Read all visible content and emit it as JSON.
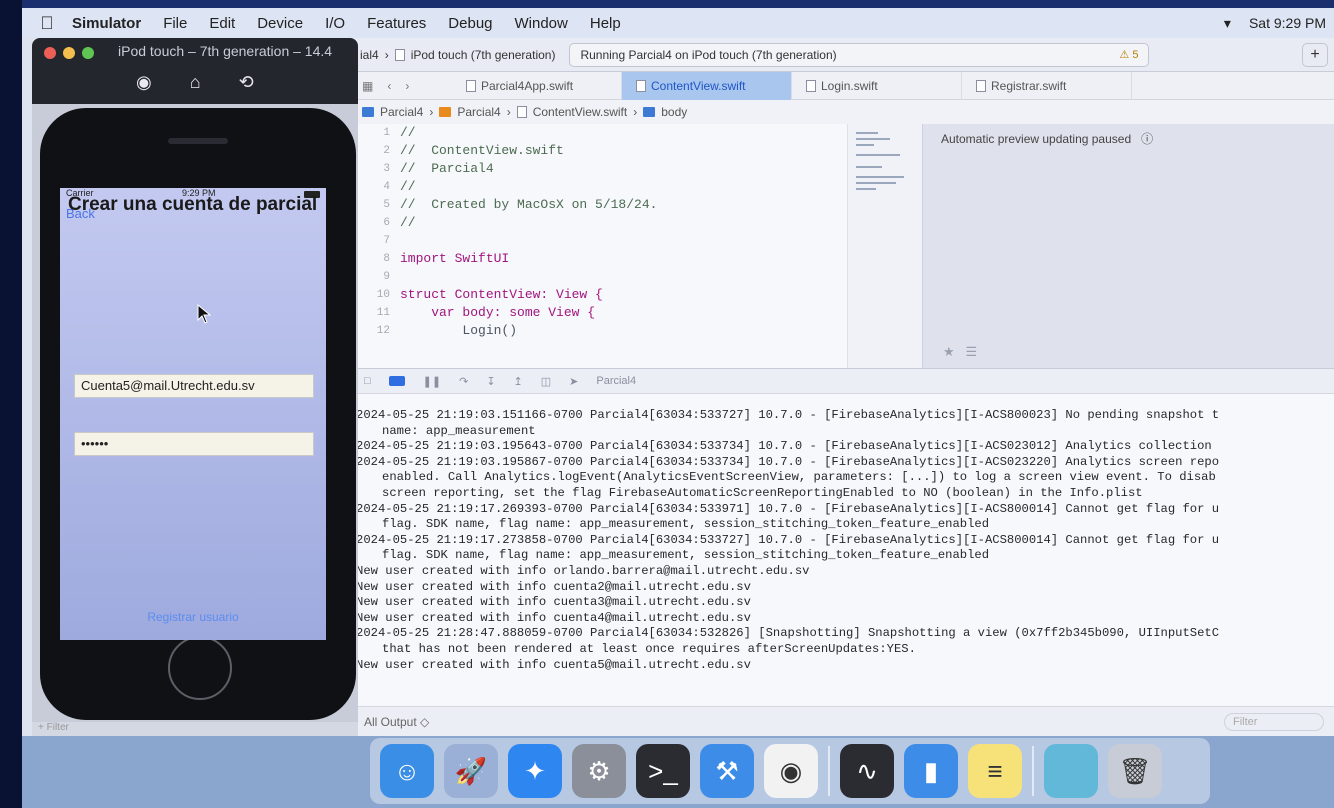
{
  "menubar": {
    "app": "Simulator",
    "items": [
      "File",
      "Edit",
      "Device",
      "I/O",
      "Features",
      "Debug",
      "Window",
      "Help"
    ],
    "clock": "Sat 9:29 PM"
  },
  "xcode": {
    "scheme_project": "ial4",
    "scheme_device": "iPod touch (7th generation)",
    "status": "Running Parcial4 on iPod touch (7th generation)",
    "warnings": "5",
    "tabs": [
      "Parcial4App.swift",
      "ContentView.swift",
      "Login.swift",
      "Registrar.swift"
    ],
    "breadcrumb": [
      "Parcial4",
      "Parcial4",
      "ContentView.swift",
      "body"
    ],
    "code": [
      {
        "n": "1",
        "t": "//",
        "k": "cm"
      },
      {
        "n": "2",
        "t": "//  ContentView.swift",
        "k": "cm"
      },
      {
        "n": "3",
        "t": "//  Parcial4",
        "k": "cm"
      },
      {
        "n": "4",
        "t": "//",
        "k": "cm"
      },
      {
        "n": "5",
        "t": "//  Created by MacOsX on 5/18/24.",
        "k": "cm"
      },
      {
        "n": "6",
        "t": "//",
        "k": "cm"
      },
      {
        "n": "7",
        "t": "",
        "k": ""
      },
      {
        "n": "8",
        "t": "import SwiftUI",
        "k": "kw"
      },
      {
        "n": "9",
        "t": "",
        "k": ""
      },
      {
        "n": "10",
        "t": "struct ContentView: View {",
        "k": "kw"
      },
      {
        "n": "11",
        "t": "    var body: some View {",
        "k": "kw"
      },
      {
        "n": "12",
        "t": "        Login()",
        "k": ""
      }
    ],
    "preview_status": "Automatic preview updating paused",
    "debug_target": "Parcial4",
    "console": [
      {
        "t": "2024-05-25 21:19:03.151166-0700 Parcial4[63034:533727] 10.7.0 - [FirebaseAnalytics][I-ACS800023] No pending snapshot t",
        "i": false
      },
      {
        "t": "name: app_measurement",
        "i": true
      },
      {
        "t": "2024-05-25 21:19:03.195643-0700 Parcial4[63034:533734] 10.7.0 - [FirebaseAnalytics][I-ACS023012] Analytics collection",
        "i": false
      },
      {
        "t": "2024-05-25 21:19:03.195867-0700 Parcial4[63034:533734] 10.7.0 - [FirebaseAnalytics][I-ACS023220] Analytics screen repo",
        "i": false
      },
      {
        "t": "enabled. Call Analytics.logEvent(AnalyticsEventScreenView, parameters: [...]) to log a screen view event. To disab",
        "i": true
      },
      {
        "t": "screen reporting, set the flag FirebaseAutomaticScreenReportingEnabled to NO (boolean) in the Info.plist",
        "i": true
      },
      {
        "t": "2024-05-25 21:19:17.269393-0700 Parcial4[63034:533971] 10.7.0 - [FirebaseAnalytics][I-ACS800014] Cannot get flag for u",
        "i": false
      },
      {
        "t": "flag. SDK name, flag name: app_measurement, session_stitching_token_feature_enabled",
        "i": true
      },
      {
        "t": "2024-05-25 21:19:17.273858-0700 Parcial4[63034:533727] 10.7.0 - [FirebaseAnalytics][I-ACS800014] Cannot get flag for u",
        "i": false
      },
      {
        "t": "flag. SDK name, flag name: app_measurement, session_stitching_token_feature_enabled",
        "i": true
      },
      {
        "t": "New user created with info orlando.barrera@mail.utrecht.edu.sv",
        "i": false
      },
      {
        "t": "New user created with info cuenta2@mail.utrecht.edu.sv",
        "i": false
      },
      {
        "t": "New user created with info cuenta3@mail.utrecht.edu.sv",
        "i": false
      },
      {
        "t": "New user created with info cuenta4@mail.utrecht.edu.sv",
        "i": false
      },
      {
        "t": "2024-05-25 21:28:47.888059-0700 Parcial4[63034:532826] [Snapshotting] Snapshotting a view (0x7ff2b345b090, UIInputSetC",
        "i": false
      },
      {
        "t": "that has not been rendered at least once requires afterScreenUpdates:YES.",
        "i": true
      },
      {
        "t": "New user created with info cuenta5@mail.utrecht.edu.sv",
        "i": false
      }
    ],
    "output_selector": "All Output ◇",
    "filter_placeholder": "Filter"
  },
  "simulator": {
    "title": "iPod touch – 7th generation – 14.4",
    "screen": {
      "carrier": "Carrier",
      "time": "9:29 PM",
      "back": "Back",
      "title": "Crear una cuenta de parcial",
      "email_value": "Cuenta5@mail.Utrecht.edu.sv",
      "password_value": "••••••",
      "register_button": "Registrar usuario"
    },
    "filter_placeholder": "Filter"
  },
  "dock": {
    "apps": [
      {
        "name": "Finder",
        "color": "#3a8ee6",
        "glyph": "☺"
      },
      {
        "name": "Launchpad",
        "color": "#9ab0d6",
        "glyph": "🚀"
      },
      {
        "name": "Safari",
        "color": "#2e86f0",
        "glyph": "✦"
      },
      {
        "name": "System Preferences",
        "color": "#8a8f99",
        "glyph": "⚙"
      },
      {
        "name": "Terminal",
        "color": "#2a2c31",
        "glyph": ">_"
      },
      {
        "name": "Xcode",
        "color": "#3d8ce8",
        "glyph": "⚒"
      },
      {
        "name": "Chrome",
        "color": "#f2f2f2",
        "glyph": "◉"
      },
      {
        "name": "Activity Monitor",
        "color": "#2a2c31",
        "glyph": "∿"
      },
      {
        "name": "Simulator",
        "color": "#3d8ce8",
        "glyph": "▮"
      },
      {
        "name": "Notes",
        "color": "#f7e27a",
        "glyph": "≡"
      },
      {
        "name": "Downloads",
        "color": "#62b8d8",
        "glyph": ""
      },
      {
        "name": "Trash",
        "color": "#c7ccd6",
        "glyph": "🗑"
      }
    ]
  }
}
